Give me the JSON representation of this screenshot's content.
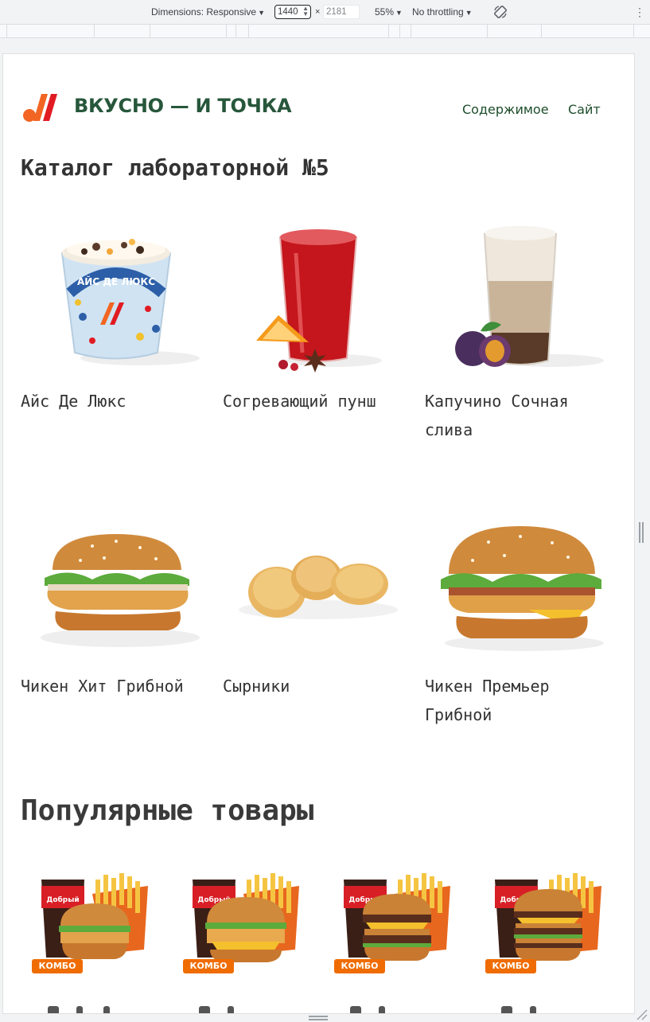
{
  "devtools": {
    "dimensions_label": "Dimensions: Responsive",
    "width_value": "1440",
    "times": "×",
    "height_value": "2181",
    "zoom": "55%",
    "throttling": "No throttling"
  },
  "site": {
    "logo_text": "ВКУСНО — И ТОЧКА",
    "nav": [
      "Содержимое",
      "Сайт"
    ]
  },
  "catalog": {
    "title": "Каталог лабораторной №5",
    "items": [
      {
        "name": "Айс Де Люкс",
        "icon": "ice-cream-cup-icon"
      },
      {
        "name": "Согревающий пунш",
        "icon": "punch-glass-icon"
      },
      {
        "name": "Капучино Сочная слива",
        "icon": "latte-glass-icon"
      },
      {
        "name": "Чикен Хит Грибной",
        "icon": "chicken-burger-icon"
      },
      {
        "name": "Сырники",
        "icon": "syrniki-icon"
      },
      {
        "name": "Чикен Премьер Грибной",
        "icon": "bacon-burger-icon"
      }
    ]
  },
  "popular": {
    "title": "Популярные товары",
    "badge": "КОМБО",
    "cup_label": "Добрый",
    "items": [
      {
        "icon": "combo-chicken-icon"
      },
      {
        "icon": "combo-crispy-icon"
      },
      {
        "icon": "combo-double-icon"
      },
      {
        "icon": "combo-bigmac-icon"
      }
    ]
  },
  "colors": {
    "brand_green": "#27573b",
    "logo_orange": "#f26522",
    "logo_red": "#e11b22",
    "badge_orange": "#ef6c00"
  }
}
